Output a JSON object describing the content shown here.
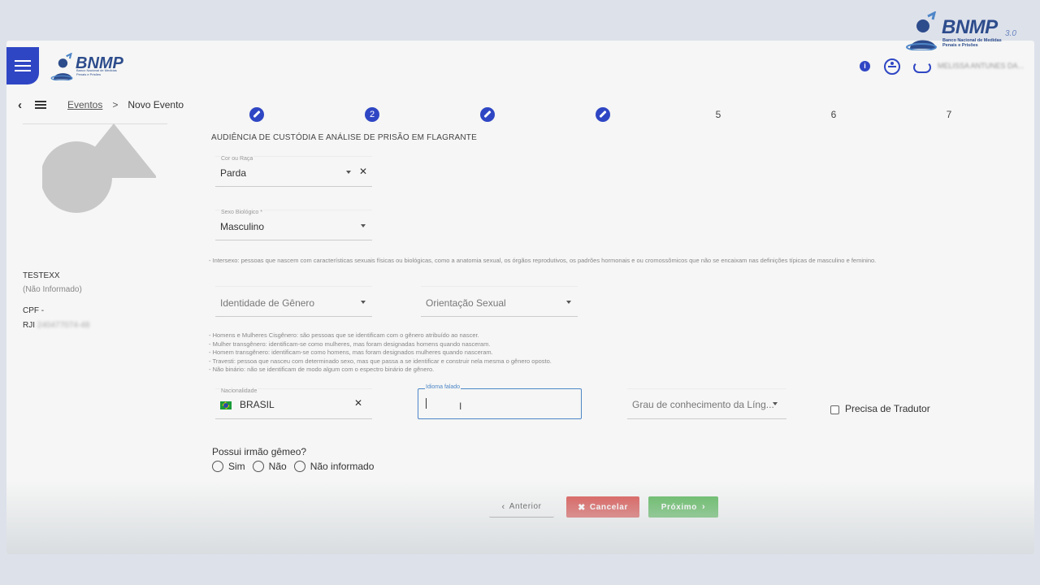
{
  "brand": {
    "watermark_name": "BNMP",
    "watermark_version": "3.0",
    "watermark_subtitle": "Banco Nacional de Medidas Penais e Prisões",
    "header_name": "BNMP",
    "header_subtitle": "Banco Nacional de Medidas Penais e Prisões",
    "primary_color": "#2f46c4"
  },
  "header": {
    "user_name": "MELISSA ANTUNES DA..."
  },
  "breadcrumb": {
    "link": "Eventos",
    "separator": ">",
    "current": "Novo Evento"
  },
  "stepper": {
    "steps": [
      {
        "label": "",
        "state": "done"
      },
      {
        "label": "2",
        "state": "active"
      },
      {
        "label": "",
        "state": "done"
      },
      {
        "label": "",
        "state": "done"
      },
      {
        "label": "5",
        "state": "pending"
      },
      {
        "label": "6",
        "state": "pending"
      },
      {
        "label": "7",
        "state": "pending"
      }
    ]
  },
  "person": {
    "name": "TESTEXX",
    "name_sub": "(Não Informado)",
    "cpf_label": "CPF -",
    "rji_label": "RJI",
    "rji_value": "240477074-48"
  },
  "form": {
    "title": "AUDIÊNCIA DE CUSTÓDIA E ANÁLISE DE PRISÃO EM FLAGRANTE",
    "cor_raca": {
      "label": "Cor ou Raça",
      "value": "Parda"
    },
    "sexo_biologico": {
      "label": "Sexo Biológico *",
      "value": "Masculino"
    },
    "intersexo_help": "- Intersexo: pessoas que nascem com características sexuais físicas ou biológicas, como a anatomia sexual, os órgãos reprodutivos, os padrões hormonais e ou cromossômicos que não se encaixam nas definições típicas de masculino e feminino.",
    "identidade_genero": {
      "placeholder": "Identidade de Gênero"
    },
    "orientacao_sexual": {
      "placeholder": "Orientação Sexual"
    },
    "genero_help": [
      "- Homens e Mulheres Cisgênero: são pessoas que se identificam com o gênero atribuído ao nascer.",
      "- Mulher transgênero: identificam-se como mulheres, mas foram designadas homens quando nasceram.",
      "- Homem transgênero: identificam-se como homens, mas foram designados mulheres quando nasceram.",
      "- Travesti: pessoa que nasceu com determinado sexo, mas que passa a se identificar e construir nela mesma o gênero oposto.",
      "- Não binário: não se identificam de modo algum com o espectro binário de gênero."
    ],
    "nacionalidade": {
      "label": "Nacionalidade",
      "value": "BRASIL"
    },
    "idioma": {
      "label": "Idioma falado",
      "value": ""
    },
    "grau_conhecimento": {
      "placeholder": "Grau de conhecimento da Líng..."
    },
    "precisa_tradutor": {
      "label": "Precisa de Tradutor",
      "checked": false
    },
    "gemeo": {
      "question": "Possui irmão gêmeo?",
      "options": [
        "Sim",
        "Não",
        "Não informado"
      ]
    }
  },
  "actions": {
    "prev": "Anterior",
    "cancel": "Cancelar",
    "next": "Próximo",
    "cancel_color": "#d9534f",
    "next_color": "#5cb85c"
  }
}
